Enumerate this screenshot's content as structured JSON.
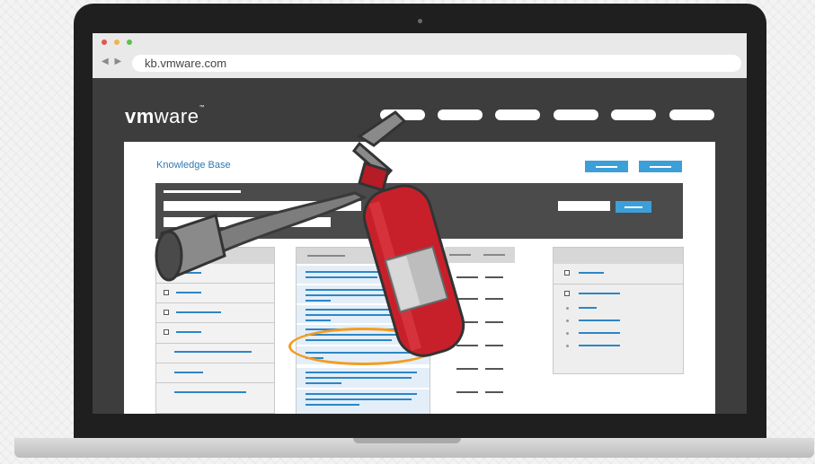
{
  "browser": {
    "nav_arrows": "◀ ▶",
    "url": "kb.vmware.com"
  },
  "site": {
    "logo_strong": "vm",
    "logo_light": "ware",
    "logo_mark": "™",
    "breadcrumb": "Knowledge Base"
  },
  "colors": {
    "accent_blue": "#3d9fd8",
    "link_blue": "#2d86c5",
    "highlight_orange": "#f39c20",
    "extinguisher_red": "#c8202a"
  },
  "icons": [
    "close-dot-icon",
    "minimize-dot-icon",
    "maximize-dot-icon",
    "fire-extinguisher-icon"
  ]
}
